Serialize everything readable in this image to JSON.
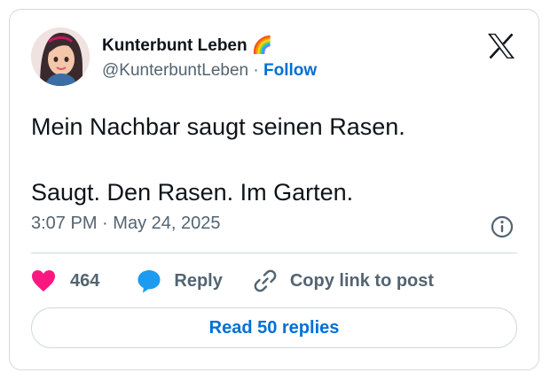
{
  "author": {
    "display_name": "Kunterbunt Leben 🌈",
    "handle": "@KunterbuntLeben",
    "separator": "·",
    "follow_label": "Follow"
  },
  "tweet": {
    "line1": "Mein Nachbar saugt seinen Rasen.",
    "line2": "Saugt. Den Rasen. Im Garten.",
    "time": "3:07 PM",
    "meta_separator": "·",
    "date": "May 24, 2025"
  },
  "actions": {
    "like_count": "464",
    "reply_label": "Reply",
    "copy_label": "Copy link to post"
  },
  "read_replies_label": "Read 50 replies",
  "icons": {
    "brand": "x-logo-icon",
    "info": "info-icon",
    "like": "heart-icon",
    "reply": "speech-bubble-icon",
    "copy": "link-icon"
  },
  "colors": {
    "link_blue": "#006fd6",
    "like_pink": "#f91880",
    "reply_blue": "#1d9bf0",
    "muted_text": "#536471",
    "border": "#cfd9de"
  }
}
